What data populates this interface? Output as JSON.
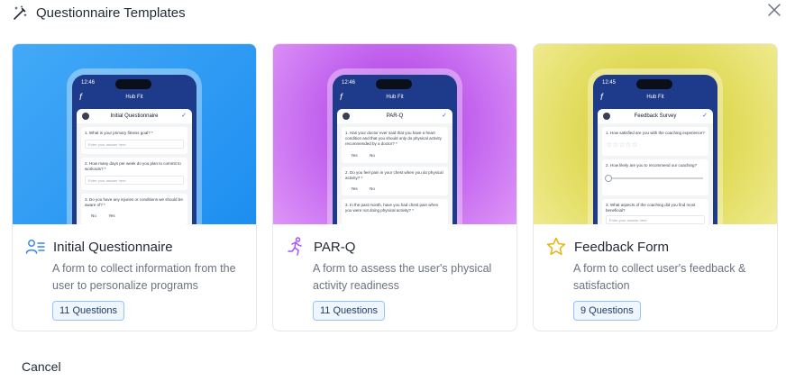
{
  "header": {
    "title": "Questionnaire Templates",
    "icon": "magic-wand-icon",
    "close_icon": "close-icon"
  },
  "cards": [
    {
      "name": "Initial Questionnaire",
      "icon": "user-list-icon",
      "description": "A form to collect information from the user to personalize programs",
      "badge": "11 Questions",
      "accent": "#2f9bf0",
      "phone": {
        "time": "12:46",
        "app_title": "Hub Fit",
        "sheet_title": "Initial Questionnaire",
        "questions": [
          {
            "text": "1. What is your primary fitness goal? *",
            "input_placeholder": "Enter your answer here"
          },
          {
            "text": "2. How many days per week do you plan to commit to workouts? *",
            "input_placeholder": "Enter your answer here"
          },
          {
            "text": "3. Do you have any injuries or conditions we should be aware of? *",
            "yes": "Yes",
            "no": "No"
          }
        ]
      }
    },
    {
      "name": "PAR-Q",
      "icon": "running-person-icon",
      "description": "A form to assess the user's physical activity readiness",
      "badge": "11 Questions",
      "accent": "#b64fe8",
      "phone": {
        "time": "12:46",
        "app_title": "Hub Fit",
        "sheet_title": "PAR-Q",
        "questions": [
          {
            "text": "1. Has your doctor ever said that you have a heart condition and that you should only do physical activity recommended by a doctor? *",
            "yes": "Yes",
            "no": "No"
          },
          {
            "text": "2. Do you feel pain in your chest when you do physical activity? *",
            "yes": "Yes",
            "no": "No"
          },
          {
            "text": "3. In the past month, have you had chest pain when you were not doing physical activity? *"
          }
        ]
      }
    },
    {
      "name": "Feedback Form",
      "icon": "star-icon",
      "description": "A form to collect user's feedback & satisfaction",
      "badge": "9 Questions",
      "accent": "#e3de5a",
      "phone": {
        "time": "12:45",
        "app_title": "Hub Fit",
        "sheet_title": "Feedback Survey",
        "questions": [
          {
            "text": "1. How satisfied are you with the coaching experience?"
          },
          {
            "text": "2. How likely are you to recommend our coaching?"
          },
          {
            "text": "3. What aspects of the coaching did you find most beneficial?",
            "input_placeholder": "Enter your answer here"
          }
        ]
      }
    }
  ],
  "footer": {
    "cancel_label": "Cancel"
  }
}
